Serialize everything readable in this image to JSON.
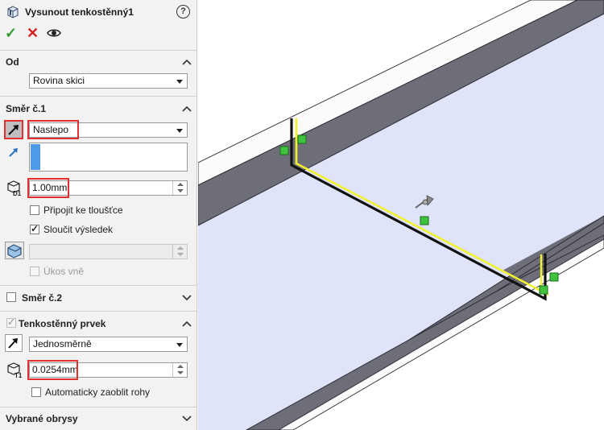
{
  "header": {
    "title": "Vysunout tenkostěnný1",
    "help": "?"
  },
  "actions": {
    "ok": "✓",
    "cancel": "✕"
  },
  "from": {
    "title": "Od",
    "value": "Rovina skici"
  },
  "direction1": {
    "title": "Směr č.1",
    "end_condition": "Naslepo",
    "depth": "1.00mm",
    "merge_thickness_label": "Připojit ke tloušťce",
    "merge_thickness_checked": false,
    "merge_result_label": "Sloučit výsledek",
    "merge_result_checked": true,
    "draft_value": "",
    "draft_outward_label": "Úkos vně",
    "draft_outward_checked": false
  },
  "direction2": {
    "title": "Směr č.2",
    "checked": false
  },
  "thin_feature": {
    "title": "Tenkostěnný prvek",
    "checked": true,
    "type": "Jednosměrně",
    "thickness": "0.0254mm",
    "auto_fillet_label": "Automaticky zaoblit rohy",
    "auto_fillet_checked": false
  },
  "selected_contours": {
    "title": "Vybrané obrysy"
  },
  "colors": {
    "highlight": "#e03030",
    "panel_bg": "#f2f2f2",
    "face_light": "#dfe4fb",
    "face_dark": "#6e6e79",
    "sketch": "#f1f130",
    "ok": "#2e9a2e",
    "cancel": "#d42222"
  },
  "icons": {
    "feature": "extrude-thin-icon",
    "preview": "eye-icon",
    "reverse": "reverse-direction-icon",
    "depth": "depth-d1-icon",
    "thickness": "thickness-t1-icon",
    "draft": "draft-icon",
    "triad": "drag-handle-icon",
    "sketch_relation": "sketch-relation-icon"
  }
}
